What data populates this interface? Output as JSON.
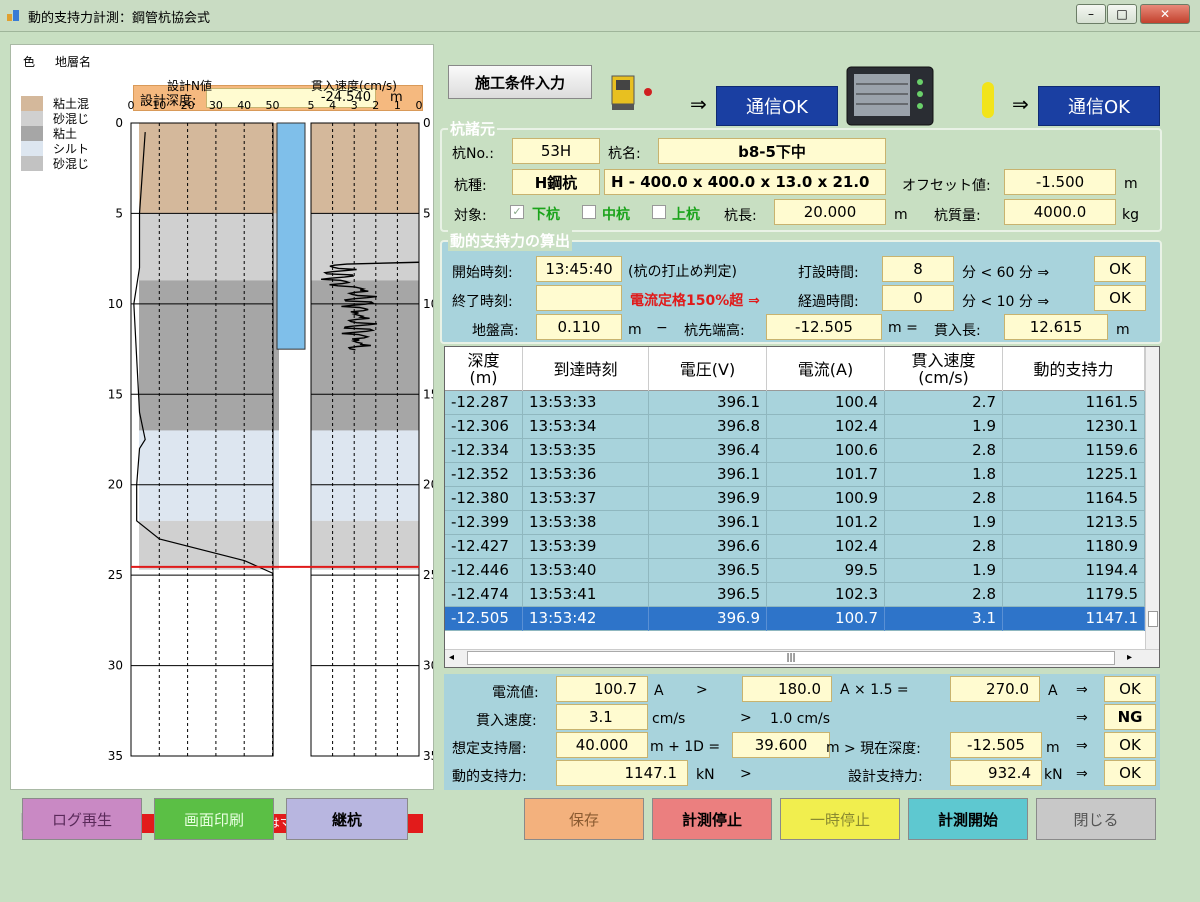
{
  "window": {
    "title": "動的支持力計測：鋼管杭協会式",
    "controls": {
      "minimize": "–",
      "maximize": "□",
      "close": "✕"
    }
  },
  "left": {
    "legend_header": {
      "color": "色",
      "name": "地層名"
    },
    "legend": [
      {
        "name": "粘土混",
        "color": "#d4b89b"
      },
      {
        "name": "砂混じ",
        "color": "#d0d0d0"
      },
      {
        "name": "粘土",
        "color": "#a6a6a6"
      },
      {
        "name": "シルト",
        "color": "#dde6f0"
      },
      {
        "name": "砂混じ",
        "color": "#c2c2c2"
      }
    ],
    "design_depth": {
      "label": "設計深度:",
      "value": "-24.540",
      "unit": "m"
    },
    "nvalue_title": "設計N値",
    "speed_title": "貫入速度(cm/s)",
    "nvalue_ticks": [
      "0",
      "10",
      "20",
      "30",
      "40",
      "50"
    ],
    "speed_ticks": [
      "5",
      "4",
      "3",
      "2",
      "1",
      "0"
    ],
    "depth_ticks": [
      "0",
      "5",
      "10",
      "15",
      "20",
      "25",
      "30",
      "35"
    ],
    "footer_note": "※グラフY軸はマイナス表示",
    "scroll_grip": "|||"
  },
  "buttons_left": [
    {
      "label": "ログ再生",
      "bg": "#c989c4",
      "color": "#5a2a5a"
    },
    {
      "label": "画面印刷",
      "bg": "#5bbf45",
      "color": "#e8ffe0"
    },
    {
      "label": "継杭",
      "bg": "#b8b6e0",
      "color": "#000"
    }
  ],
  "buttons_right": [
    {
      "label": "保存",
      "bg": "#f3b17d",
      "color": "#8a5a30"
    },
    {
      "label": "計測停止",
      "bg": "#eb7f7f",
      "color": "#000"
    },
    {
      "label": "一時停止",
      "bg": "#f1ee4e",
      "color": "#8a8a30"
    },
    {
      "label": "計測開始",
      "bg": "#5ec8d0",
      "color": "#000"
    },
    {
      "label": "閉じる",
      "bg": "#c8c8c8",
      "color": "#555"
    }
  ],
  "top": {
    "cond_button": "施工条件入力",
    "comm1": "通信OK",
    "comm2": "通信OK",
    "arrow": "⇒"
  },
  "pile": {
    "section_title": "杭諸元",
    "no_label": "杭No.:",
    "no_value": "53H",
    "name_label": "杭名:",
    "name_value": "b8-5下中",
    "type_label": "杭種:",
    "type_value": "H鋼杭",
    "size_value": "H - 400.0 x 400.0 x 13.0 x 21.0",
    "offset_label": "オフセット値:",
    "offset_value": "-1.500",
    "offset_unit": "m",
    "target_label": "対象:",
    "target_lower": "下杭",
    "target_middle": "中杭",
    "target_upper": "上杭",
    "length_label": "杭長:",
    "length_value": "20.000",
    "length_unit": "m",
    "mass_label": "杭質量:",
    "mass_value": "4000.0",
    "mass_unit": "kg"
  },
  "calc": {
    "section_title": "動的支持力の算出",
    "start_label": "開始時刻:",
    "start_value": "13:45:40",
    "judge_note": "(杭の打止め判定)",
    "drive_time_label": "打設時間:",
    "drive_time_value": "8",
    "drive_cmp": "分 < 60 分 ⇒",
    "drive_ok": "OK",
    "end_label": "終了時刻:",
    "end_value": "",
    "warning": "電流定格150%超 ⇒",
    "elapsed_label": "経過時間:",
    "elapsed_value": "0",
    "elapsed_cmp": "分 < 10 分 ⇒",
    "elapsed_ok": "OK",
    "ground_label": "地盤高:",
    "ground_value": "0.110",
    "ground_unit": "m",
    "minus": "−",
    "tip_label": "杭先端高:",
    "tip_value": "-12.505",
    "eq": "m =",
    "pen_label": "貫入長:",
    "pen_value": "12.615",
    "pen_unit": "m"
  },
  "table": {
    "headers": [
      "深度\n(m)",
      "到達時刻",
      "電圧(V)",
      "電流(A)",
      "貫入速度\n(cm/s)",
      "動的支持力"
    ],
    "rows": [
      [
        "-12.287",
        "13:53:33",
        "396.1",
        "100.4",
        "2.7",
        "1161.5"
      ],
      [
        "-12.306",
        "13:53:34",
        "396.8",
        "102.4",
        "1.9",
        "1230.1"
      ],
      [
        "-12.334",
        "13:53:35",
        "396.4",
        "100.6",
        "2.8",
        "1159.6"
      ],
      [
        "-12.352",
        "13:53:36",
        "396.1",
        "101.7",
        "1.8",
        "1225.1"
      ],
      [
        "-12.380",
        "13:53:37",
        "396.9",
        "100.9",
        "2.8",
        "1164.5"
      ],
      [
        "-12.399",
        "13:53:38",
        "396.1",
        "101.2",
        "1.9",
        "1213.5"
      ],
      [
        "-12.427",
        "13:53:39",
        "396.6",
        "102.4",
        "2.8",
        "1180.9"
      ],
      [
        "-12.446",
        "13:53:40",
        "396.5",
        "99.5",
        "1.9",
        "1194.4"
      ],
      [
        "-12.474",
        "13:53:41",
        "396.5",
        "102.3",
        "2.8",
        "1179.5"
      ],
      [
        "-12.505",
        "13:53:42",
        "396.9",
        "100.7",
        "3.1",
        "1147.1"
      ]
    ],
    "selected_row": 9,
    "hscroll_grip": "|||"
  },
  "judge": {
    "current_label": "電流値:",
    "current_value": "100.7",
    "current_unit": "A",
    "gt": ">",
    "rated_value": "180.0",
    "rated_mul": "A × 1.5 =",
    "limit_value": "270.0",
    "limit_unit": "A",
    "current_ok": "OK",
    "speed_label": "貫入速度:",
    "speed_value": "3.1",
    "speed_unit": "cm/s",
    "speed_cmp": "1.0  cm/s",
    "speed_result": "NG",
    "layer_label": "想定支持層:",
    "layer_value": "40.000",
    "layer_plus": "m + 1D =",
    "layer_sum": "39.600",
    "layer_unit": "m",
    "now_label": "> 現在深度:",
    "now_value": "-12.505",
    "now_unit": "m",
    "layer_ok": "OK",
    "dyn_label": "動的支持力:",
    "dyn_value": "1147.1",
    "dyn_unit": "kN",
    "design_label": "設計支持力:",
    "design_value": "932.4",
    "design_unit": "kN",
    "dyn_ok": "OK"
  }
}
